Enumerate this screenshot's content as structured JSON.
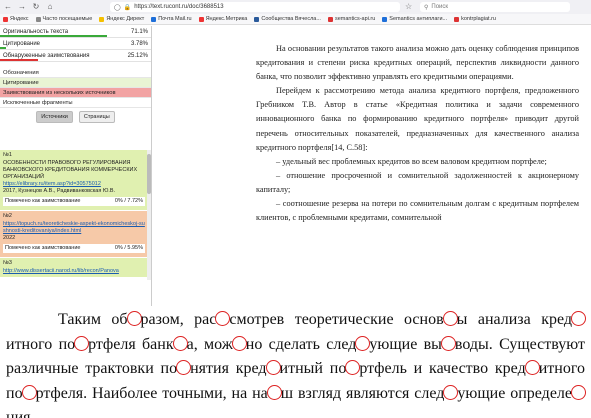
{
  "browser": {
    "url": "https://text.rucont.ru/doc/3688513",
    "search_placeholder": "Поиск",
    "bookmarks": [
      {
        "label": "Яндекс",
        "color": "#e33"
      },
      {
        "label": "Часто посещаемые",
        "color": "#888"
      },
      {
        "label": "Яндекс Директ",
        "color": "#f5c000"
      },
      {
        "label": "Почта Mail.ru",
        "color": "#1e6fd9"
      },
      {
        "label": "Яндекс.Метрика",
        "color": "#e33"
      },
      {
        "label": "Сообщества Вячесла...",
        "color": "#2a5a9b"
      },
      {
        "label": "semantics-api.ru",
        "color": "#d33"
      },
      {
        "label": "Semantics антиплаги...",
        "color": "#1e6fd9"
      },
      {
        "label": "kontrplagiat.ru",
        "color": "#d33"
      }
    ]
  },
  "report": {
    "metrics": [
      {
        "label": "Оригинальность текста",
        "value": "71.1%",
        "fraction": 0.711,
        "color": "#39a939"
      },
      {
        "label": "Цитирование",
        "value": "3.78%",
        "fraction": 0.0378,
        "color": "#39a939"
      },
      {
        "label": "Обнаруженные заимствования",
        "value": "25.12%",
        "fraction": 0.2512,
        "color": "#d33"
      }
    ],
    "legend_title": "Обозначения",
    "categories": {
      "citation": "Цитирование",
      "multi": "Заимствования из нескольких источников",
      "excluded": "Исключенные фрагменты"
    },
    "tabs": {
      "sources": "Источники",
      "pages": "Страницы"
    },
    "sources": [
      {
        "num": "№1",
        "title": "ОСОБЕННОСТИ ПРАВОВОГО РЕГУЛИРОВАНИЯ БАНКОВСКОГО КРЕДИТОВАНИЯ КОММЕРЧЕСКИХ ОРГАНИЗАЦИЙ",
        "link": "https://elibrary.ru/item.asp?id=30575012",
        "meta": "2017, Кузнецов А.В., Радвиванковская Ю.В.",
        "mark_label": "Помечено как заимствование",
        "percent": "0% / 7.72%"
      },
      {
        "num": "№2",
        "link": "https://topuch.ru/teoreticheskie-aspekt-ekonomicheskoj-sushnosti-kreditovaniya/index.html",
        "meta": "2022",
        "mark_label": "Помечено как заимствование",
        "percent": "0% / 5.95%"
      },
      {
        "num": "№3",
        "link": "http://www.dissertacii.narod.ru/lib/recon/Panova"
      }
    ]
  },
  "document": {
    "p1": "На основании результатов такого анализа можно дать оценку соблюдения принципов кредитования и степени риска кредитных операций, перспектив ликвидности данного банка, что позволит эффективно управлять его кредитными операциями.",
    "p2": "Перейдем к рассмотрению метода анализа кредитного портфеля, предложенного Гребником Т.В. Автор в статье «Кредитная политика и задачи современного инновационного банка по формированию кредитного портфеля» приводит другой перечень относительных показателей, предназначенных для качественного анализа кредитного портфеля[14, С.58]:",
    "items": [
      "– удельный вес проблемных кредитов во всем валовом кредитном портфеле;",
      "– отношение просроченной и сомнительной задолженностей к акционерному капиталу;",
      "– соотношение резерва на потери по сомнительным долгам с кредитным портфелем клиентов, с проблемными кредитами, сомнительной"
    ]
  },
  "zoom": {
    "segments": [
      "Таким об",
      "разом, рас",
      "смотрев теоретические основ",
      "ы анализа кред",
      "итного ",
      "по",
      "ртфеля банк",
      "а, мож",
      "но сделать след",
      "ующие вы",
      "воды. Существуют различные трактовки по",
      "нятия кред",
      "итный по",
      "ртфель и качество кред",
      "итного по",
      "ртфеля. Наиболее точными, на на",
      "ш взгляд являются след",
      "ующие определе",
      "ния."
    ]
  }
}
